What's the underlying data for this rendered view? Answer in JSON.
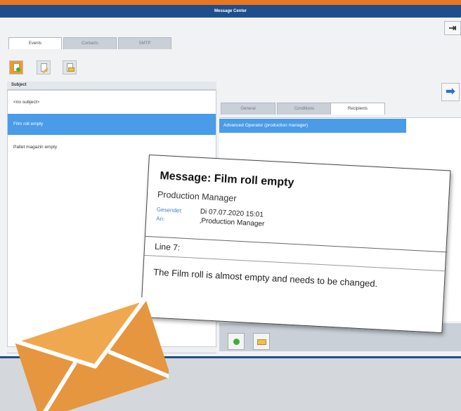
{
  "window": {
    "title": "Message Center"
  },
  "tabs": [
    {
      "label": "Events",
      "active": true
    },
    {
      "label": "Contacts",
      "active": false
    },
    {
      "label": "SMTP",
      "active": false
    }
  ],
  "toolbar": {
    "icons": [
      "new-message-icon",
      "edit-message-icon",
      "open-folder-icon"
    ]
  },
  "subject_list": {
    "header": "Subject",
    "items": [
      {
        "label": "<no subject>",
        "selected": false
      },
      {
        "label": "Film roll empty",
        "selected": true
      },
      {
        "label": "Pallet magazin empty",
        "selected": false
      }
    ]
  },
  "detail_tabs": [
    {
      "label": "General",
      "active": false
    },
    {
      "label": "Conditions",
      "active": false
    },
    {
      "label": "Recipients",
      "active": true
    }
  ],
  "recipients": [
    {
      "label": "Advanced Operator (production manager)",
      "selected": true
    }
  ],
  "email": {
    "title": "Message: Film roll empty",
    "from": "Production Manager",
    "sent_label": "Gesendet:",
    "sent_value": "Di 07.07.2020 15:01",
    "to_label": "An:",
    "to_value": "‚Production Manager",
    "line": "Line 7:",
    "body": "The Film roll is almost empty and needs to be changed."
  },
  "colors": {
    "accent_orange": "#e87722",
    "title_blue": "#1f4e8c",
    "selection_blue": "#4a9be8",
    "envelope_orange": "#e5963e"
  }
}
